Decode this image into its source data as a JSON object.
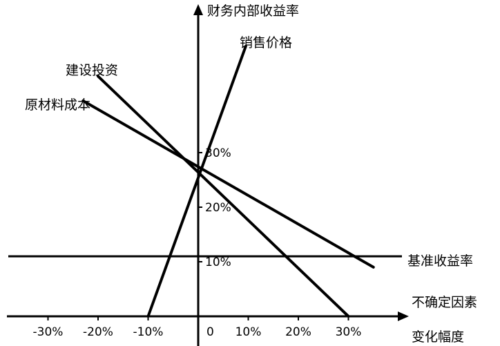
{
  "chart_data": {
    "type": "line",
    "title": "",
    "ylabel": "财务内部收益率",
    "xlabel": "不确定因素变化幅度",
    "xlabel_lines": [
      "不确定因素",
      "变化幅度"
    ],
    "x_ticks": [
      "-30%",
      "-20%",
      "-10%",
      "0",
      "10%",
      "20%",
      "30%"
    ],
    "y_ticks": [
      "10%",
      "20%",
      "30%"
    ],
    "xlim": [
      -40,
      43
    ],
    "ylim": [
      -1,
      51
    ],
    "grid": false,
    "series": [
      {
        "name": "销售价格",
        "x": [
          -10,
          9.5
        ],
        "y": [
          0,
          49.5
        ]
      },
      {
        "name": "建设投资",
        "x": [
          -20,
          30
        ],
        "y": [
          44,
          0
        ]
      },
      {
        "name": "原材料成本",
        "x": [
          -23,
          35
        ],
        "y": [
          39.5,
          9
        ]
      }
    ],
    "reference_lines": [
      {
        "name": "基准收益率",
        "y": 11
      }
    ],
    "base_point": {
      "x": 0,
      "y": 26
    }
  }
}
